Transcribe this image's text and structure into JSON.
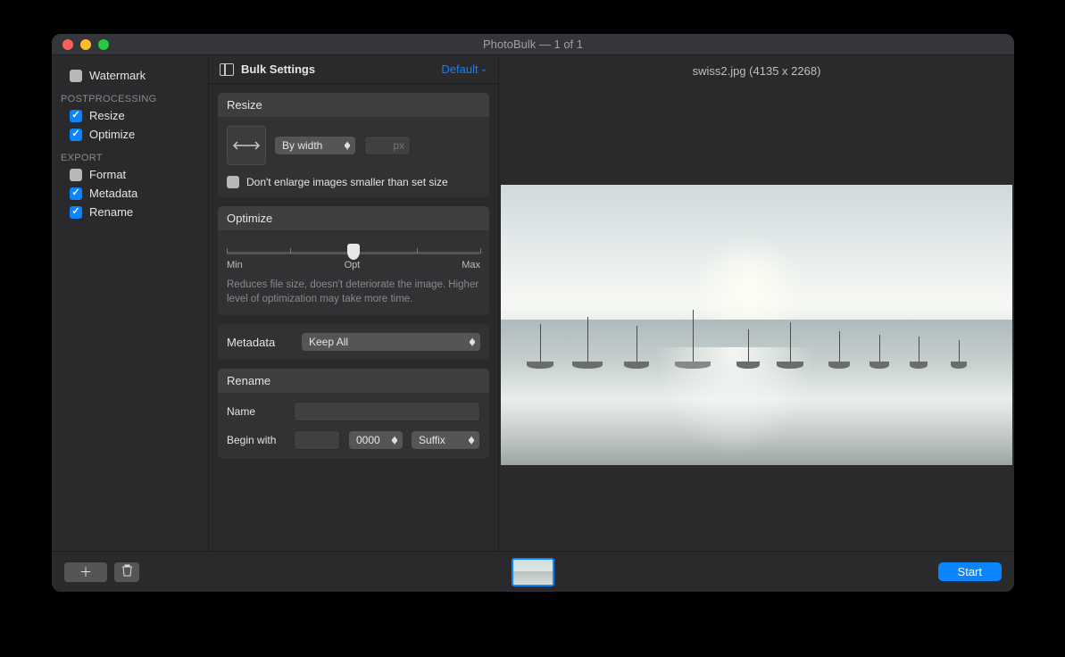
{
  "window": {
    "title": "PhotoBulk — 1 of 1"
  },
  "sidebar": {
    "watermark": {
      "label": "Watermark",
      "checked": false
    },
    "sections": {
      "postprocessing": {
        "label": "POSTPROCESSING",
        "items": [
          {
            "label": "Resize",
            "checked": true
          },
          {
            "label": "Optimize",
            "checked": true
          }
        ]
      },
      "export": {
        "label": "EXPORT",
        "items": [
          {
            "label": "Format",
            "checked": false
          },
          {
            "label": "Metadata",
            "checked": true
          },
          {
            "label": "Rename",
            "checked": true
          }
        ]
      }
    }
  },
  "settings": {
    "header_title": "Bulk Settings",
    "default_link": "Default",
    "resize": {
      "title": "Resize",
      "mode": "By width",
      "unit": "px",
      "dont_enlarge_label": "Don't enlarge images smaller than set size",
      "dont_enlarge_checked": false
    },
    "optimize": {
      "title": "Optimize",
      "labels": {
        "min": "Min",
        "opt": "Opt",
        "max": "Max"
      },
      "desc": "Reduces file size, doesn't deteriorate the image. Higher level of optimization may take more time."
    },
    "metadata": {
      "title": "Metadata",
      "value": "Keep All"
    },
    "rename": {
      "title": "Rename",
      "name_label": "Name",
      "name_value": "",
      "begin_label": "Begin with",
      "begin_value": "",
      "digits": "0000",
      "position": "Suffix"
    }
  },
  "preview": {
    "label": "swiss2.jpg (4135 x 2268)"
  },
  "footer": {
    "start": "Start"
  }
}
